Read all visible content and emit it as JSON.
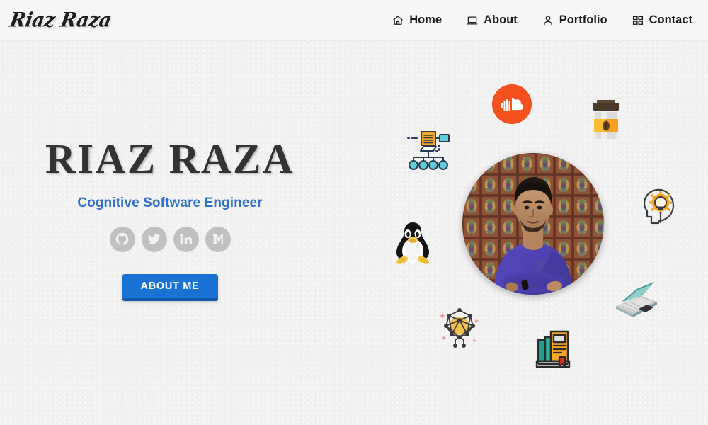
{
  "header": {
    "brand": "Riaz Raza",
    "nav": [
      {
        "label": "Home",
        "icon": "home-icon"
      },
      {
        "label": "About",
        "icon": "laptop-icon"
      },
      {
        "label": "Portfolio",
        "icon": "person-icon"
      },
      {
        "label": "Contact",
        "icon": "grid-apps-icon"
      }
    ]
  },
  "hero": {
    "name": "RIAZ RAZA",
    "tagline": "Cognitive Software Engineer",
    "cta_label": "ABOUT ME",
    "social": [
      {
        "name": "github-icon",
        "label": "GitHub"
      },
      {
        "name": "twitter-icon",
        "label": "Twitter"
      },
      {
        "name": "linkedin-icon",
        "label": "LinkedIn"
      },
      {
        "name": "medium-icon",
        "label": "Medium"
      }
    ],
    "profile_photo_alt": "Portrait of Riaz Raza in a purple shirt with arms crossed in front of an ornate patterned wall",
    "floating_icons": [
      {
        "name": "soundcloud-icon",
        "label": "SoundCloud"
      },
      {
        "name": "coffee-cup-icon",
        "label": "Coffee Cup"
      },
      {
        "name": "network-diagram-icon",
        "label": "Network Diagram"
      },
      {
        "name": "linux-penguin-icon",
        "label": "Linux"
      },
      {
        "name": "idea-head-icon",
        "label": "Idea Head"
      },
      {
        "name": "laptop-icon",
        "label": "Laptop"
      },
      {
        "name": "neural-network-icon",
        "label": "Neural Network"
      },
      {
        "name": "books-icon",
        "label": "Books"
      }
    ]
  },
  "colors": {
    "page_background": "#f1f1f1",
    "header_background": "#f7f7f7",
    "heading_text": "#333333",
    "tagline_accent": "#2f6fd0",
    "button_fill": "#1a73d4",
    "button_shadow": "#125aa8",
    "social_circle": "#c0c0c0",
    "soundcloud_orange": "#f4511e"
  }
}
